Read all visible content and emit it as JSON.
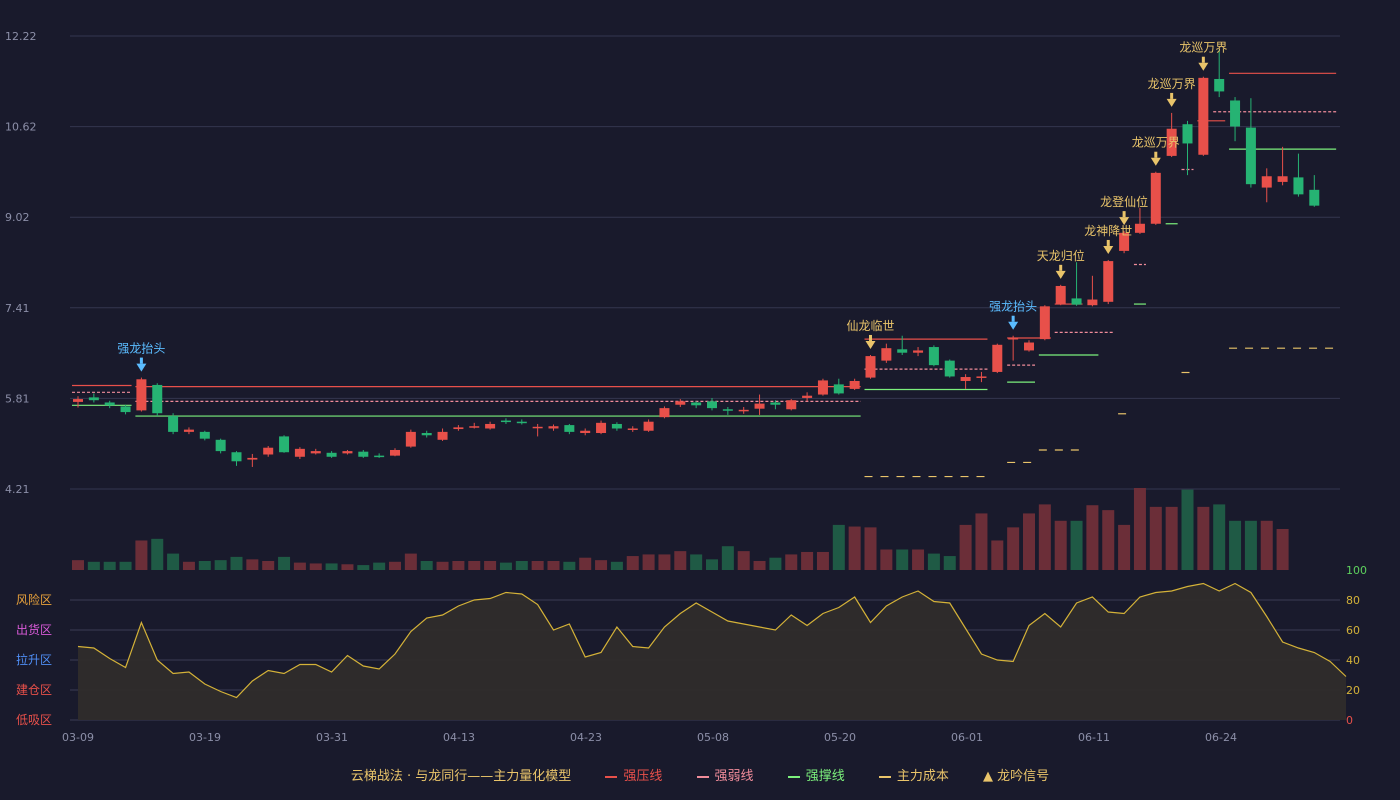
{
  "chart_data": {
    "type": "candlestick",
    "x_ticks": [
      "03-09",
      "03-19",
      "03-31",
      "04-13",
      "04-23",
      "05-08",
      "05-20",
      "06-01",
      "06-11",
      "06-24"
    ],
    "y_ticks": [
      "12.22",
      "10.62",
      "9.02",
      "7.41",
      "5.81",
      "4.21"
    ],
    "ylim": [
      4.21,
      12.22
    ],
    "osc_ticks": [
      "100",
      "80",
      "60",
      "40",
      "20",
      "0"
    ],
    "osc_ylim": [
      0,
      100
    ],
    "zones": [
      {
        "label": "风险区",
        "color": "#e9a23b"
      },
      {
        "label": "出货区",
        "color": "#d95ad8"
      },
      {
        "label": "拉升区",
        "color": "#4f8ef5"
      },
      {
        "label": "建仓区",
        "color": "#e8504a"
      },
      {
        "label": "低吸区",
        "color": "#e8504a"
      }
    ],
    "colors": {
      "up": "#e8504a",
      "down": "#26b373",
      "resist": "#e8504a",
      "weak": "#f08c9a",
      "support": "#7cf07c",
      "cost": "#e9c46a",
      "signal": "#e9c46a",
      "osc": "#d4b238",
      "vol_up": "#6b2e38",
      "vol_down": "#1f5a45"
    },
    "candles": [
      {
        "o": 5.75,
        "c": 5.8,
        "h": 5.85,
        "l": 5.65
      },
      {
        "o": 5.83,
        "c": 5.78,
        "h": 5.9,
        "l": 5.74
      },
      {
        "o": 5.74,
        "c": 5.69,
        "h": 5.77,
        "l": 5.64
      },
      {
        "o": 5.67,
        "c": 5.57,
        "h": 5.7,
        "l": 5.53
      },
      {
        "o": 5.6,
        "c": 6.15,
        "h": 6.18,
        "l": 5.58
      },
      {
        "o": 6.05,
        "c": 5.55,
        "h": 6.08,
        "l": 5.5
      },
      {
        "o": 5.5,
        "c": 5.22,
        "h": 5.55,
        "l": 5.18
      },
      {
        "o": 5.22,
        "c": 5.26,
        "h": 5.3,
        "l": 5.18
      },
      {
        "o": 5.22,
        "c": 5.1,
        "h": 5.24,
        "l": 5.07
      },
      {
        "o": 5.08,
        "c": 4.88,
        "h": 5.1,
        "l": 4.84
      },
      {
        "o": 4.86,
        "c": 4.7,
        "h": 4.88,
        "l": 4.62
      },
      {
        "o": 4.73,
        "c": 4.76,
        "h": 4.83,
        "l": 4.6
      },
      {
        "o": 4.82,
        "c": 4.94,
        "h": 4.97,
        "l": 4.78
      },
      {
        "o": 5.14,
        "c": 4.86,
        "h": 5.16,
        "l": 4.85
      },
      {
        "o": 4.78,
        "c": 4.92,
        "h": 4.95,
        "l": 4.74
      },
      {
        "o": 4.84,
        "c": 4.88,
        "h": 4.92,
        "l": 4.82
      },
      {
        "o": 4.85,
        "c": 4.78,
        "h": 4.88,
        "l": 4.76
      },
      {
        "o": 4.84,
        "c": 4.88,
        "h": 4.9,
        "l": 4.82
      },
      {
        "o": 4.87,
        "c": 4.78,
        "h": 4.9,
        "l": 4.76
      },
      {
        "o": 4.8,
        "c": 4.78,
        "h": 4.84,
        "l": 4.76
      },
      {
        "o": 4.8,
        "c": 4.9,
        "h": 4.93,
        "l": 4.79
      },
      {
        "o": 4.96,
        "c": 5.22,
        "h": 5.26,
        "l": 4.94
      },
      {
        "o": 5.2,
        "c": 5.16,
        "h": 5.24,
        "l": 5.12
      },
      {
        "o": 5.08,
        "c": 5.22,
        "h": 5.28,
        "l": 5.06
      },
      {
        "o": 5.27,
        "c": 5.3,
        "h": 5.34,
        "l": 5.24
      },
      {
        "o": 5.3,
        "c": 5.32,
        "h": 5.38,
        "l": 5.28
      },
      {
        "o": 5.28,
        "c": 5.36,
        "h": 5.4,
        "l": 5.26
      },
      {
        "o": 5.42,
        "c": 5.4,
        "h": 5.46,
        "l": 5.36
      },
      {
        "o": 5.4,
        "c": 5.38,
        "h": 5.44,
        "l": 5.35
      },
      {
        "o": 5.3,
        "c": 5.31,
        "h": 5.36,
        "l": 5.14
      },
      {
        "o": 5.28,
        "c": 5.32,
        "h": 5.35,
        "l": 5.24
      },
      {
        "o": 5.34,
        "c": 5.22,
        "h": 5.36,
        "l": 5.18
      },
      {
        "o": 5.2,
        "c": 5.24,
        "h": 5.28,
        "l": 5.16
      },
      {
        "o": 5.2,
        "c": 5.38,
        "h": 5.42,
        "l": 5.18
      },
      {
        "o": 5.36,
        "c": 5.28,
        "h": 5.39,
        "l": 5.24
      },
      {
        "o": 5.26,
        "c": 5.28,
        "h": 5.32,
        "l": 5.22
      },
      {
        "o": 5.24,
        "c": 5.4,
        "h": 5.44,
        "l": 5.22
      },
      {
        "o": 5.48,
        "c": 5.64,
        "h": 5.67,
        "l": 5.46
      },
      {
        "o": 5.7,
        "c": 5.76,
        "h": 5.8,
        "l": 5.66
      },
      {
        "o": 5.74,
        "c": 5.69,
        "h": 5.76,
        "l": 5.64
      },
      {
        "o": 5.76,
        "c": 5.64,
        "h": 5.82,
        "l": 5.6
      },
      {
        "o": 5.62,
        "c": 5.6,
        "h": 5.66,
        "l": 5.52
      },
      {
        "o": 5.6,
        "c": 5.61,
        "h": 5.66,
        "l": 5.54
      },
      {
        "o": 5.63,
        "c": 5.72,
        "h": 5.88,
        "l": 5.52
      },
      {
        "o": 5.74,
        "c": 5.7,
        "h": 5.78,
        "l": 5.62
      },
      {
        "o": 5.62,
        "c": 5.78,
        "h": 5.8,
        "l": 5.6
      },
      {
        "o": 5.82,
        "c": 5.86,
        "h": 5.92,
        "l": 5.76
      },
      {
        "o": 5.88,
        "c": 6.13,
        "h": 6.16,
        "l": 5.86
      },
      {
        "o": 6.06,
        "c": 5.9,
        "h": 6.16,
        "l": 5.88
      },
      {
        "o": 5.98,
        "c": 6.12,
        "h": 6.16,
        "l": 5.96
      },
      {
        "o": 6.18,
        "c": 6.56,
        "h": 6.58,
        "l": 6.16
      },
      {
        "o": 6.48,
        "c": 6.7,
        "h": 6.78,
        "l": 6.44
      },
      {
        "o": 6.68,
        "c": 6.62,
        "h": 6.92,
        "l": 6.58
      },
      {
        "o": 6.62,
        "c": 6.66,
        "h": 6.72,
        "l": 6.56
      },
      {
        "o": 6.72,
        "c": 6.4,
        "h": 6.75,
        "l": 6.38
      },
      {
        "o": 6.48,
        "c": 6.2,
        "h": 6.5,
        "l": 6.18
      },
      {
        "o": 6.12,
        "c": 6.19,
        "h": 6.24,
        "l": 5.98
      },
      {
        "o": 6.18,
        "c": 6.2,
        "h": 6.28,
        "l": 6.1
      },
      {
        "o": 6.28,
        "c": 6.76,
        "h": 6.78,
        "l": 6.26
      },
      {
        "o": 6.86,
        "c": 6.88,
        "h": 6.92,
        "l": 6.48
      },
      {
        "o": 6.66,
        "c": 6.8,
        "h": 6.84,
        "l": 6.64
      },
      {
        "o": 6.86,
        "c": 7.44,
        "h": 7.46,
        "l": 6.84
      },
      {
        "o": 7.48,
        "c": 7.8,
        "h": 7.82,
        "l": 7.46
      },
      {
        "o": 7.58,
        "c": 7.47,
        "h": 8.22,
        "l": 7.45
      },
      {
        "o": 7.46,
        "c": 7.56,
        "h": 7.98,
        "l": 7.44
      },
      {
        "o": 7.52,
        "c": 8.24,
        "h": 8.26,
        "l": 7.48
      },
      {
        "o": 8.42,
        "c": 8.74,
        "h": 8.77,
        "l": 8.38
      },
      {
        "o": 8.74,
        "c": 8.9,
        "h": 9.18,
        "l": 8.72
      },
      {
        "o": 8.9,
        "c": 9.8,
        "h": 9.82,
        "l": 8.88
      },
      {
        "o": 10.1,
        "c": 10.58,
        "h": 10.86,
        "l": 10.08
      },
      {
        "o": 10.66,
        "c": 10.32,
        "h": 10.72,
        "l": 9.76
      },
      {
        "o": 10.12,
        "c": 11.48,
        "h": 11.5,
        "l": 10.1
      },
      {
        "o": 11.46,
        "c": 11.24,
        "h": 11.98,
        "l": 11.14
      },
      {
        "o": 11.08,
        "c": 10.62,
        "h": 11.14,
        "l": 10.36
      },
      {
        "o": 10.6,
        "c": 9.6,
        "h": 11.12,
        "l": 9.54
      },
      {
        "o": 9.54,
        "c": 9.74,
        "h": 9.88,
        "l": 9.28
      },
      {
        "o": 9.64,
        "c": 9.74,
        "h": 10.26,
        "l": 9.58
      },
      {
        "o": 9.72,
        "c": 9.42,
        "h": 10.14,
        "l": 9.38
      },
      {
        "o": 9.5,
        "c": 9.22,
        "h": 9.76,
        "l": 9.2
      }
    ],
    "volume_max": 100,
    "volumes": [
      12,
      10,
      10,
      10,
      36,
      38,
      20,
      10,
      11,
      12,
      16,
      13,
      11,
      16,
      9,
      8,
      8,
      7,
      6,
      9,
      10,
      20,
      11,
      10,
      11,
      11,
      11,
      9,
      11,
      11,
      11,
      10,
      15,
      12,
      10,
      17,
      19,
      19,
      23,
      19,
      13,
      29,
      23,
      11,
      15,
      19,
      22,
      22,
      55,
      53,
      52,
      25,
      25,
      25,
      20,
      17,
      55,
      69,
      36,
      52,
      69,
      80,
      60,
      60,
      79,
      73,
      55,
      100,
      77,
      77,
      98,
      77,
      80,
      60,
      60,
      60,
      50
    ],
    "resist_lines": [
      {
        "x0": 0,
        "x1": 3,
        "y": 6.04
      },
      {
        "x0": 4,
        "x1": 49,
        "y": 6.02
      },
      {
        "x0": 50,
        "x1": 57,
        "y": 6.86
      },
      {
        "x0": 59,
        "x1": 61,
        "y": 6.88
      },
      {
        "x0": 62,
        "x1": 63,
        "y": 7.48
      },
      {
        "x0": 71,
        "x1": 72,
        "y": 10.72
      },
      {
        "x0": 73,
        "x1": 79,
        "y": 11.56
      }
    ],
    "weak_lines": [
      {
        "x0": 0,
        "x1": 3,
        "y": 5.92
      },
      {
        "x0": 4,
        "x1": 49,
        "y": 5.76
      },
      {
        "x0": 50,
        "x1": 57,
        "y": 6.33
      },
      {
        "x0": 59,
        "x1": 60,
        "y": 6.4
      },
      {
        "x0": 62,
        "x1": 65,
        "y": 6.98
      },
      {
        "x0": 67,
        "x1": 67,
        "y": 8.18
      },
      {
        "x0": 70,
        "x1": 70,
        "y": 9.86
      },
      {
        "x0": 72,
        "x1": 79,
        "y": 10.88
      }
    ],
    "support_lines": [
      {
        "x0": 0,
        "x1": 3,
        "y": 5.69
      },
      {
        "x0": 4,
        "x1": 49,
        "y": 5.5
      },
      {
        "x0": 50,
        "x1": 57,
        "y": 5.97
      },
      {
        "x0": 59,
        "x1": 60,
        "y": 6.1
      },
      {
        "x0": 61,
        "x1": 64,
        "y": 6.58
      },
      {
        "x0": 67,
        "x1": 67,
        "y": 7.48
      },
      {
        "x0": 69,
        "x1": 69,
        "y": 8.9
      },
      {
        "x0": 73,
        "x1": 79,
        "y": 10.22
      }
    ],
    "cost_lines": [
      {
        "x0": 50,
        "x1": 57,
        "y": 4.43
      },
      {
        "x0": 59,
        "x1": 60,
        "y": 4.68
      },
      {
        "x0": 61,
        "x1": 63,
        "y": 4.9
      },
      {
        "x0": 66,
        "x1": 66,
        "y": 5.54
      },
      {
        "x0": 70,
        "x1": 70,
        "y": 6.27
      },
      {
        "x0": 73,
        "x1": 79,
        "y": 6.7
      }
    ],
    "signals": [
      {
        "i": 4,
        "text": "强龙抬头",
        "color": "#5bbcff"
      },
      {
        "i": 50,
        "text": "仙龙临世",
        "color": "#e9c46a"
      },
      {
        "i": 59,
        "text": "强龙抬头",
        "color": "#5bbcff"
      },
      {
        "i": 62,
        "text": "天龙归位",
        "color": "#e9c46a"
      },
      {
        "i": 65,
        "text": "龙神降世",
        "color": "#e9c46a"
      },
      {
        "i": 66,
        "text": "龙登仙位",
        "color": "#e9c46a"
      },
      {
        "i": 68,
        "text": "龙巡万界",
        "color": "#e9c46a"
      },
      {
        "i": 69,
        "text": "龙巡万界",
        "color": "#e9c46a"
      },
      {
        "i": 71,
        "text": "龙巡万界",
        "color": "#e9c46a"
      }
    ],
    "oscillator": [
      49,
      48,
      41,
      35,
      65,
      40,
      31,
      32,
      24,
      19,
      15,
      26,
      33,
      31,
      37,
      37,
      32,
      43,
      36,
      34,
      44,
      59,
      68,
      70,
      76,
      80,
      81,
      85,
      84,
      77,
      60,
      64,
      42,
      45,
      62,
      49,
      48,
      62,
      71,
      78,
      72,
      66,
      64,
      62,
      60,
      70,
      63,
      71,
      75,
      82,
      65,
      76,
      82,
      86,
      79,
      78,
      61,
      44,
      40,
      39,
      63,
      71,
      62,
      78,
      82,
      72,
      71,
      82,
      85,
      86,
      89,
      91,
      86,
      91,
      85,
      69,
      52,
      48,
      45,
      39,
      29
    ],
    "legend": {
      "title": "云梯战法 · 与龙同行——主力量化模型",
      "resist": "强压线",
      "weak": "强弱线",
      "support": "强撑线",
      "cost": "主力成本",
      "signal": "龙吟信号"
    }
  }
}
